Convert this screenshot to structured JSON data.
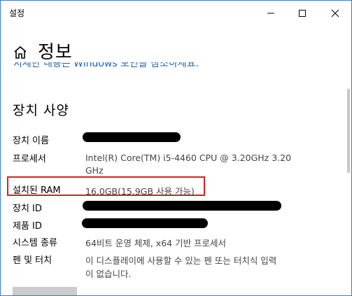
{
  "window": {
    "title": "설정"
  },
  "header": {
    "page_title": "정보",
    "clipped_link_text": "지세한 내용은 Windows 보안을 참조하세요."
  },
  "section": {
    "title": "장치 사양"
  },
  "specs": {
    "device_name_label": "장치 이름",
    "processor_label": "프로세서",
    "processor_value_line1": "Intel(R) Core(TM) i5-4460  CPU @ 3.20GHz   3.20",
    "processor_value_line2": "GHz",
    "ram_label": "설치된 RAM",
    "ram_value": "16.0GB(15.9GB 사용 가능)",
    "device_id_label": "장치 ID",
    "product_id_label": "제품 ID",
    "system_type_label": "시스템 종류",
    "system_type_value": "64비트 운영 체제, x64 기반 프로세서",
    "pen_touch_label": "펜 및 터치",
    "pen_touch_value_line1": "이 디스플레이에 사용할 수 있는 펜 또는 터치식 입력",
    "pen_touch_value_line2": "이 없습니다."
  },
  "colors": {
    "accent_link": "#1f5fb8",
    "highlight_border": "#d52027",
    "window_border": "#3b7ccf"
  },
  "icons": {
    "home": "home-icon",
    "minimize": "minimize-icon",
    "maximize": "maximize-icon",
    "close": "close-icon"
  }
}
